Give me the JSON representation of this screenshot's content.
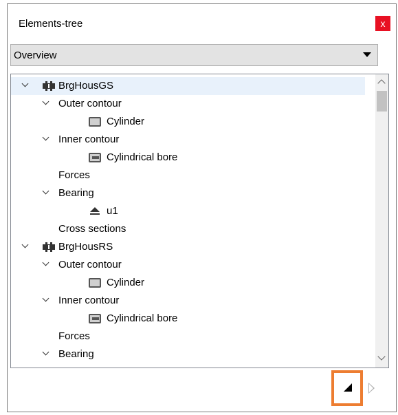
{
  "window": {
    "title": "Elements-tree",
    "close_label": "x"
  },
  "dropdown": {
    "value": "Overview"
  },
  "tree": {
    "items": [
      {
        "label": "BrgHousGS",
        "icon": "housing-icon",
        "expanded": true
      },
      {
        "label": "Outer contour",
        "expanded": true
      },
      {
        "label": "Cylinder",
        "icon": "cylinder-icon"
      },
      {
        "label": "Inner contour",
        "expanded": true
      },
      {
        "label": "Cylindrical bore",
        "icon": "bore-icon"
      },
      {
        "label": "Forces"
      },
      {
        "label": "Bearing",
        "expanded": true
      },
      {
        "label": "u1",
        "icon": "bearing-icon"
      },
      {
        "label": "Cross sections"
      },
      {
        "label": "BrgHousRS",
        "icon": "housing-icon",
        "expanded": true
      },
      {
        "label": "Outer contour",
        "expanded": true
      },
      {
        "label": "Cylinder",
        "icon": "cylinder-icon"
      },
      {
        "label": "Inner contour",
        "expanded": true
      },
      {
        "label": "Cylindrical bore",
        "icon": "bore-icon"
      },
      {
        "label": "Forces"
      },
      {
        "label": "Bearing",
        "expanded": true
      }
    ]
  },
  "highlight_color": "#ed7d31"
}
